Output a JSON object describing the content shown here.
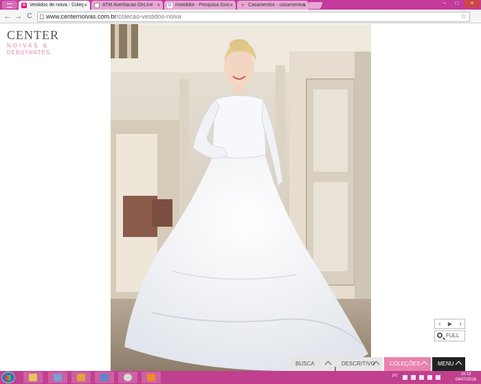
{
  "browser": {
    "tabs": [
      {
        "label": "Vestidos de noiva - Coleç",
        "active": true,
        "favicon_color": "#e6007e"
      },
      {
        "label": "ATM Averbacao OnLine",
        "active": false,
        "favicon_color": "#888888"
      },
      {
        "label": "motobike - Pesquisa Goo",
        "active": false,
        "favicon_color": "#4285f4"
      },
      {
        "label": "Casamentos - casamentos",
        "active": false,
        "favicon_color": "#e63c5a"
      }
    ],
    "close_glyph": "×",
    "url_host": "www.centernoivas.com.br",
    "url_path": "/colecao-vestidos-noiva",
    "nav": {
      "back": "←",
      "forward": "→",
      "reload": "C",
      "star": "☆"
    },
    "window_controls": {
      "minimize": "–",
      "maximize": "□",
      "close": "×"
    }
  },
  "site": {
    "logo": {
      "line1": "CENTER",
      "line2": "NOIVAS &",
      "line3": "DEBUTANTES"
    },
    "slider": {
      "prev": "‹",
      "play": "▶",
      "next": "›"
    },
    "full_label": "FULL",
    "bottom_nav": {
      "busca": "BUSCA",
      "descritivo": "DESCRITIVO",
      "colecoes": "COLEÇÕES",
      "menu": "MENU"
    },
    "colors": {
      "accent_pink": "#e982ad",
      "logo_gray": "#555555",
      "menu_dark": "#222222"
    }
  },
  "taskbar": {
    "language": "PT",
    "time": "16:13",
    "date": "04/07/2016",
    "items": [
      "explorer-icon",
      "network-icon",
      "outlook-icon",
      "remote-desktop-icon",
      "chrome-icon",
      "app-icon"
    ]
  }
}
